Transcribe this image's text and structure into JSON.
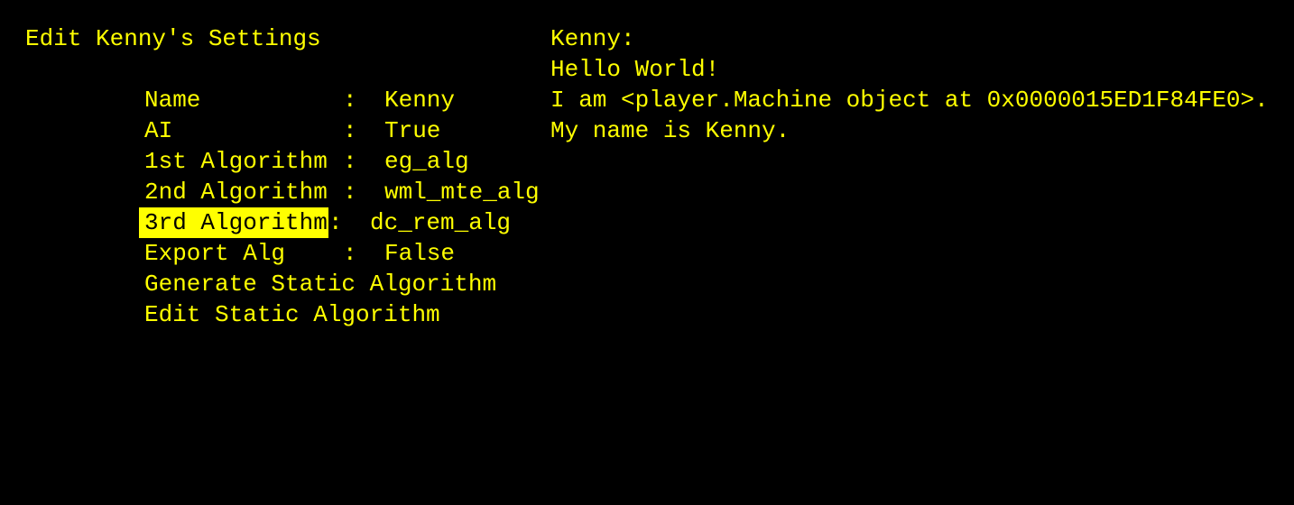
{
  "title": "Edit Kenny's Settings",
  "separator": ":",
  "settings": [
    {
      "label": "Name",
      "value": "Kenny",
      "selected": false
    },
    {
      "label": "AI",
      "value": "True",
      "selected": false
    },
    {
      "label": "1st Algorithm",
      "value": "eg_alg",
      "selected": false
    },
    {
      "label": "2nd Algorithm",
      "value": "wml_mte_alg",
      "selected": false
    },
    {
      "label": "3rd Algorithm",
      "value": "dc_rem_alg",
      "selected": true
    },
    {
      "label": "Export Alg",
      "value": "False",
      "selected": false
    }
  ],
  "actions": [
    "Generate Static Algorithm",
    "Edit Static Algorithm"
  ],
  "output": [
    "Kenny:",
    "Hello World!",
    "I am <player.Machine object at 0x0000015ED1F84FE0>.",
    "My name is Kenny."
  ]
}
